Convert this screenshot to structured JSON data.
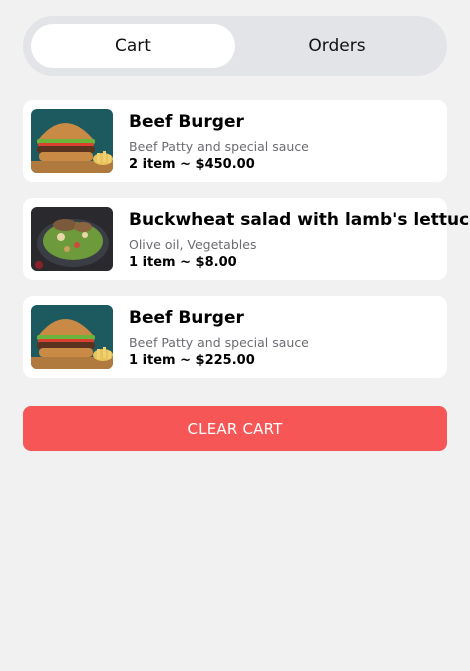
{
  "tabs": {
    "cart_label": "Cart",
    "orders_label": "Orders",
    "active": "Cart"
  },
  "cart": {
    "items": [
      {
        "name": "Beef Burger",
        "description": "Beef Patty and special sauce",
        "quantity_price": "2 item ~ $450.00",
        "image": "burger-image"
      },
      {
        "name": "Buckwheat salad with lamb's lettuce",
        "description": " Olive oil, Vegetables",
        "quantity_price": "1 item ~ $8.00",
        "image": "salad-image"
      },
      {
        "name": "Beef Burger",
        "description": "Beef Patty and special sauce",
        "quantity_price": "1 item ~ $225.00",
        "image": "burger-image"
      }
    ]
  },
  "actions": {
    "clear_cart_label": "CLEAR CART"
  },
  "colors": {
    "accent": "#f75656",
    "tab_track": "#e3e4e8",
    "background": "#f1f1f1"
  }
}
